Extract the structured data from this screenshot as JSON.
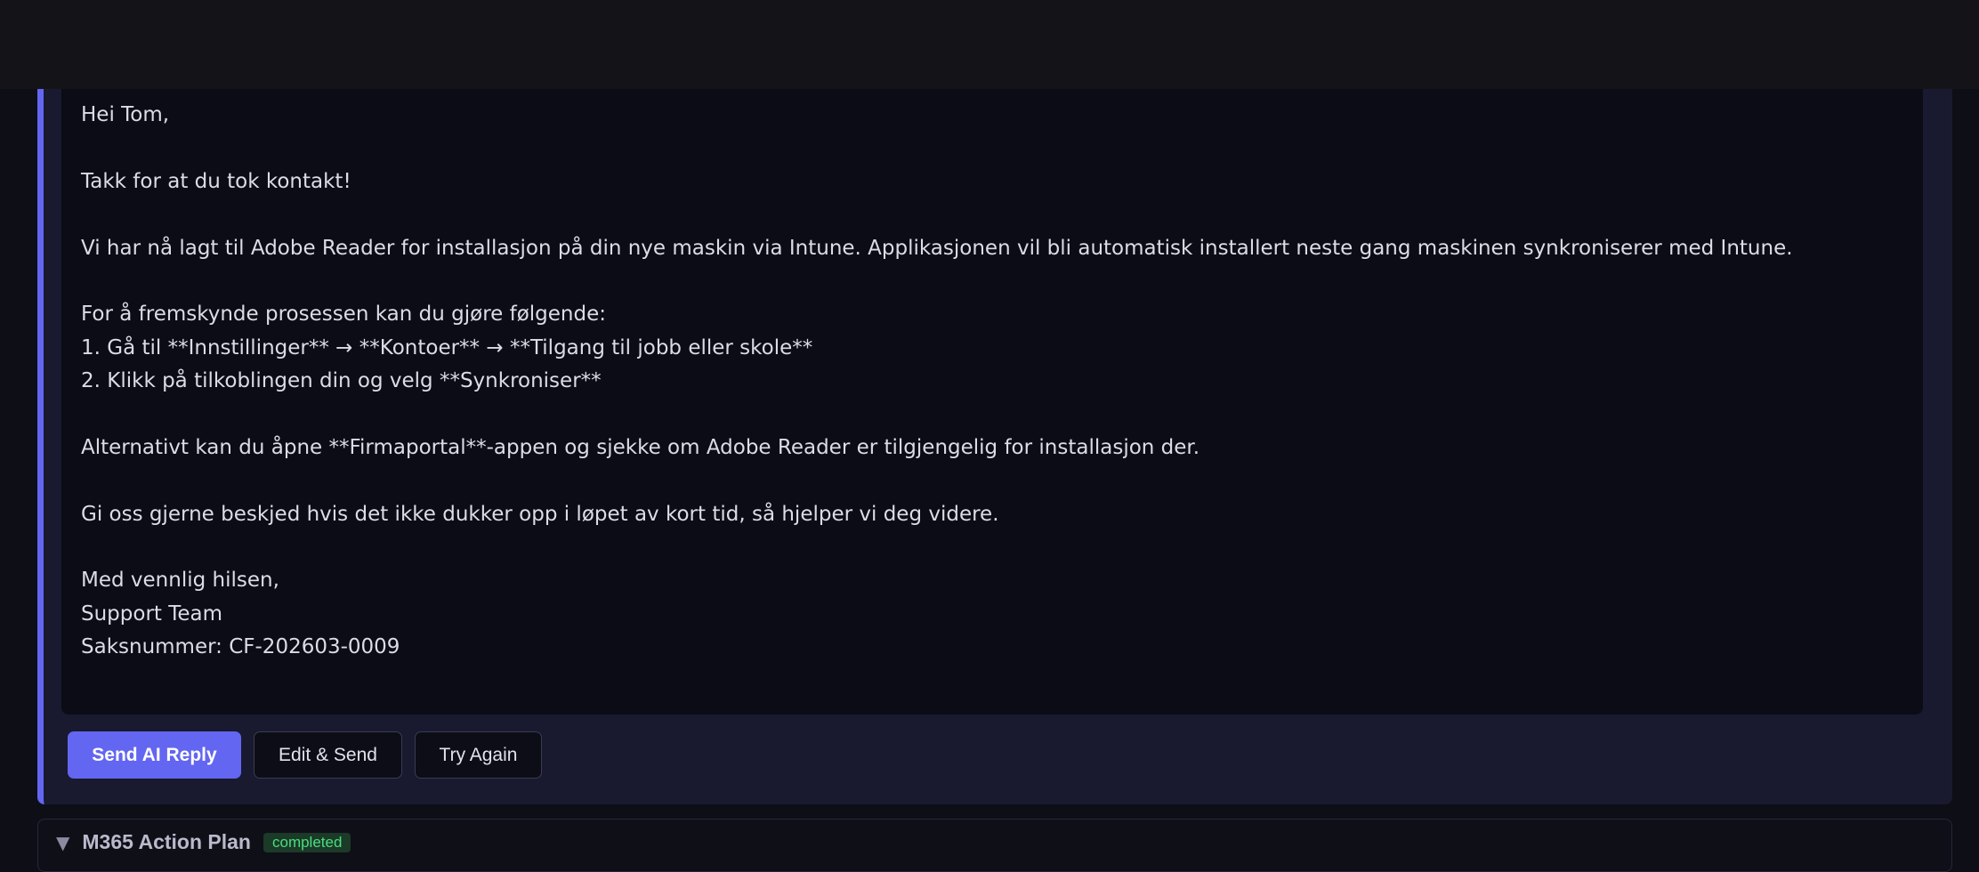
{
  "reply": {
    "lines": [
      "Hei Tom,",
      "",
      "Takk for at du tok kontakt!",
      "",
      "Vi har nå lagt til Adobe Reader for installasjon på din nye maskin via Intune. Applikasjonen vil bli automatisk installert neste gang maskinen synkroniserer med Intune.",
      "",
      "For å fremskynde prosessen kan du gjøre følgende:",
      "1. Gå til **Innstillinger** → **Kontoer** → **Tilgang til jobb eller skole**",
      "2. Klikk på tilkoblingen din og velg **Synkroniser**",
      "",
      "Alternativt kan du åpne **Firmaportal**-appen og sjekke om Adobe Reader er tilgjengelig for installasjon der.",
      "",
      "Gi oss gjerne beskjed hvis det ikke dukker opp i løpet av kort tid, så hjelper vi deg videre.",
      "",
      "Med vennlig hilsen,",
      "Support Team",
      "Saksnummer: CF-202603-0009"
    ]
  },
  "actions": {
    "send_label": "Send AI Reply",
    "edit_label": "Edit & Send",
    "retry_label": "Try Again"
  },
  "next_section": {
    "chevron": "▼",
    "title": "M365 Action Plan",
    "status": "completed"
  },
  "colors": {
    "accent": "#6366f1",
    "status_green": "#4ade80"
  }
}
